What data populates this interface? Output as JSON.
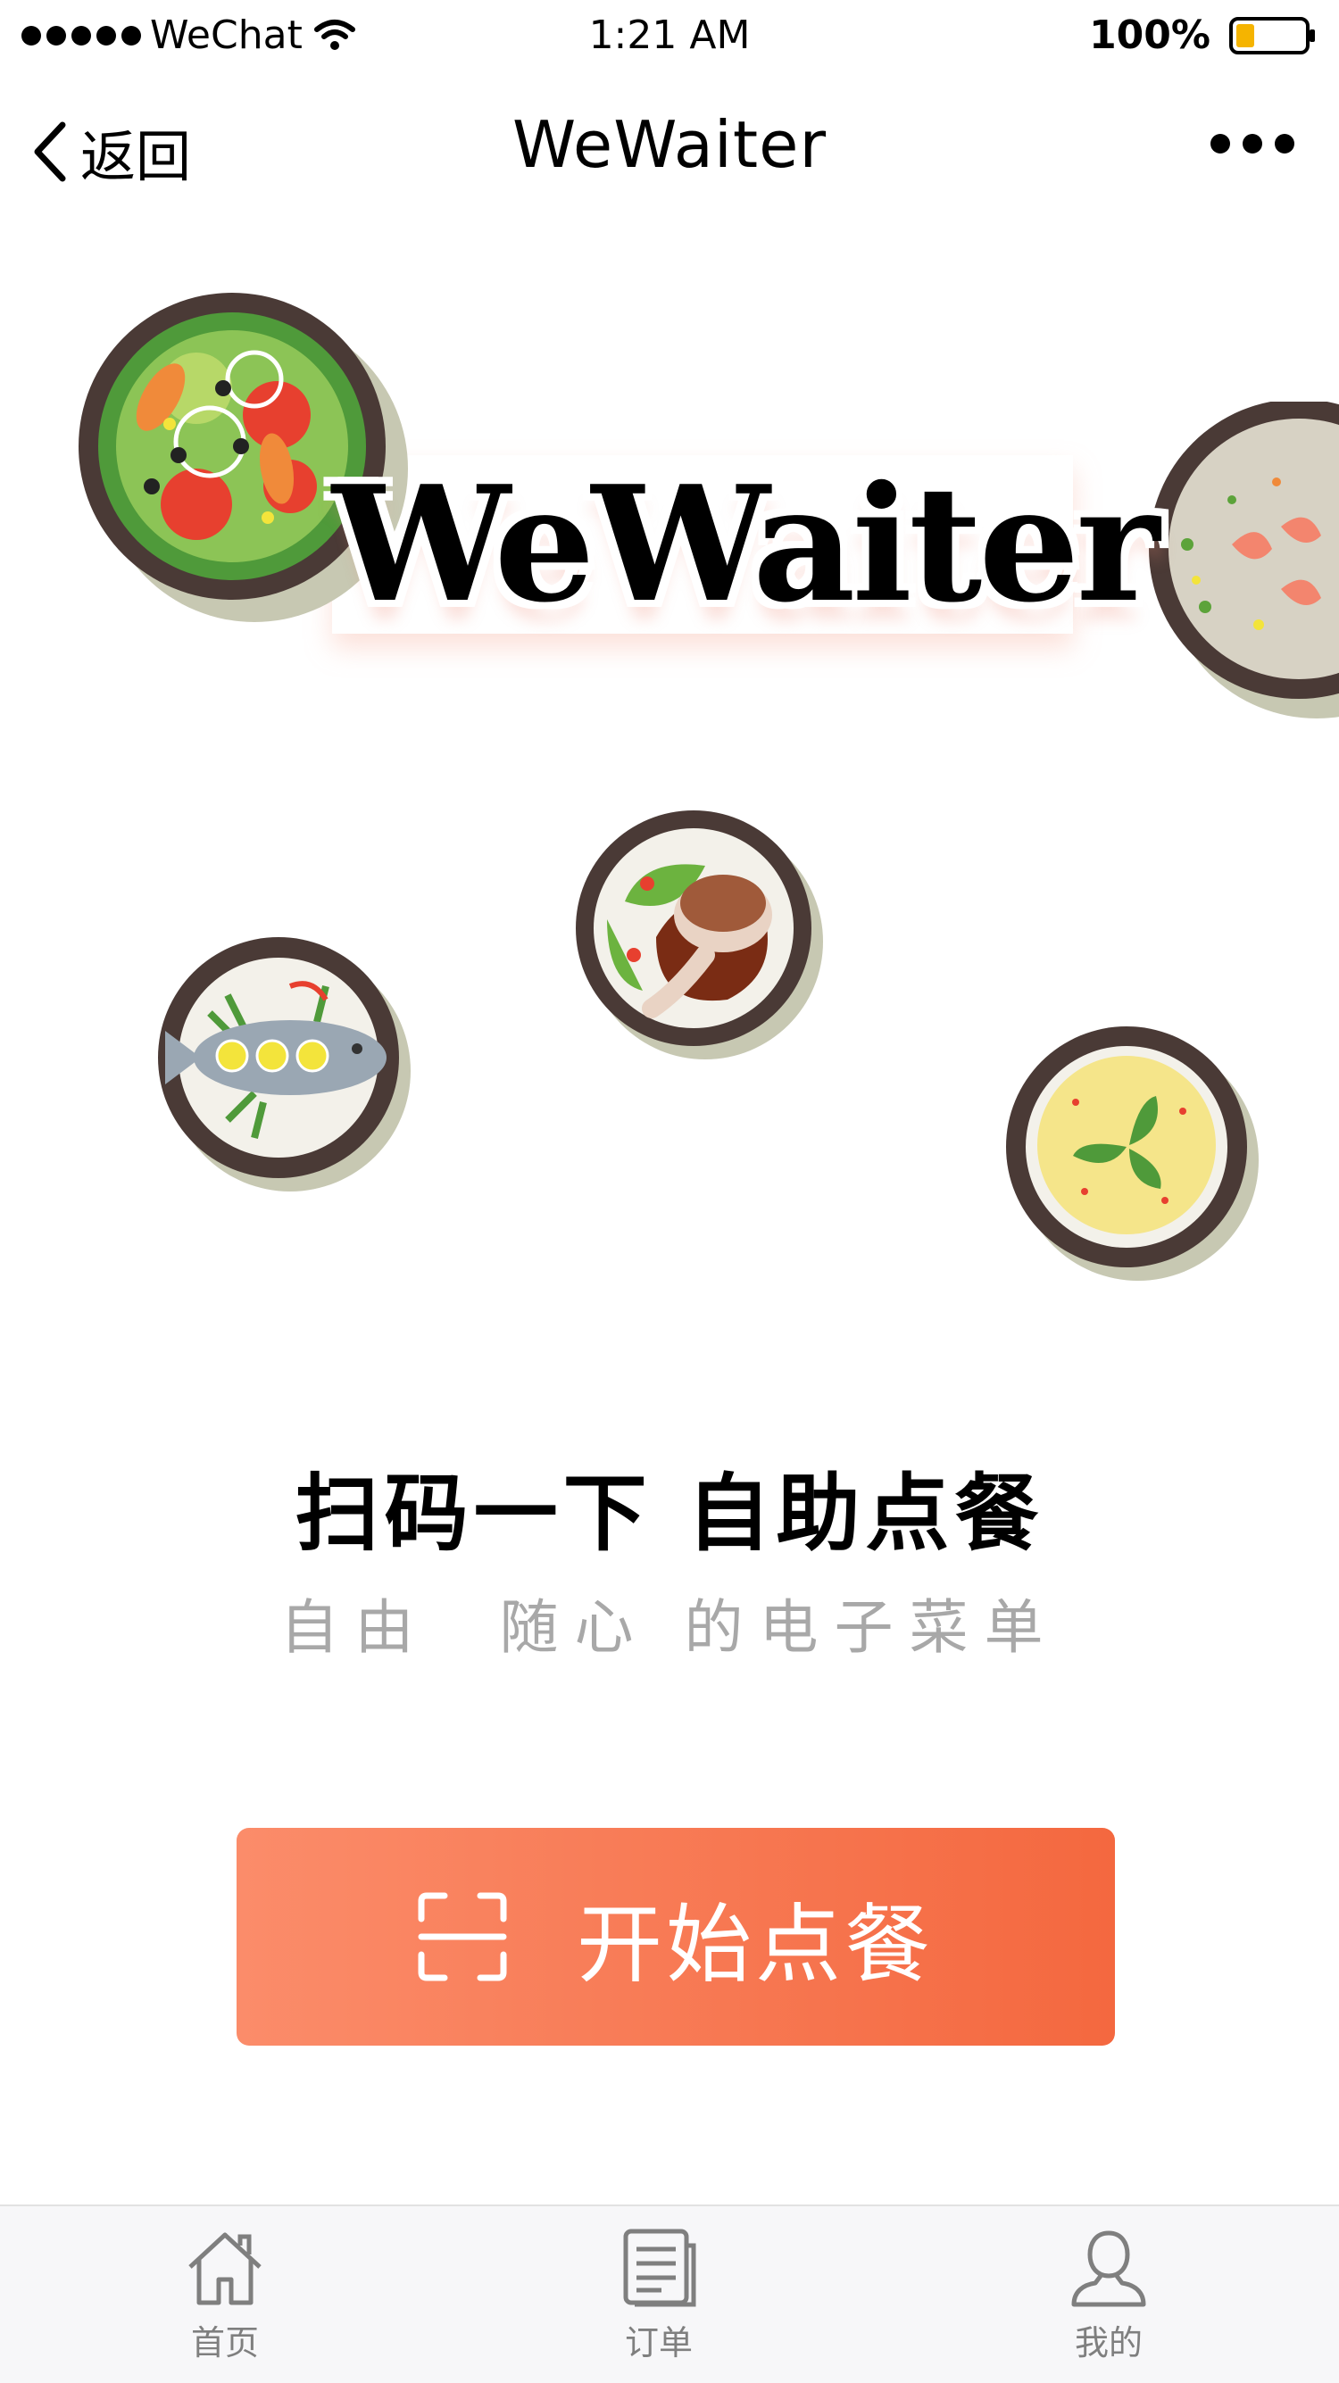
{
  "status_bar": {
    "carrier": "WeChat",
    "time": "1:21 AM",
    "battery": "100%"
  },
  "nav": {
    "back_label": "返回",
    "title": "WeWaiter"
  },
  "hero": {
    "logo_text": "WeWaiter"
  },
  "intro": {
    "headline": "扫码一下 自助点餐",
    "subline": "自由  随心 的电子菜单"
  },
  "start_button": {
    "label": "开始点餐"
  },
  "tab_bar": {
    "items": [
      {
        "label": "首页",
        "icon": "home-icon"
      },
      {
        "label": "订单",
        "icon": "order-icon"
      },
      {
        "label": "我的",
        "icon": "profile-icon"
      }
    ]
  },
  "colors": {
    "button_gradient_start": "#fb8c6a",
    "button_gradient_end": "#f4683f",
    "subline_text": "#a8a8a8",
    "tab_label": "#7f7f7f"
  }
}
